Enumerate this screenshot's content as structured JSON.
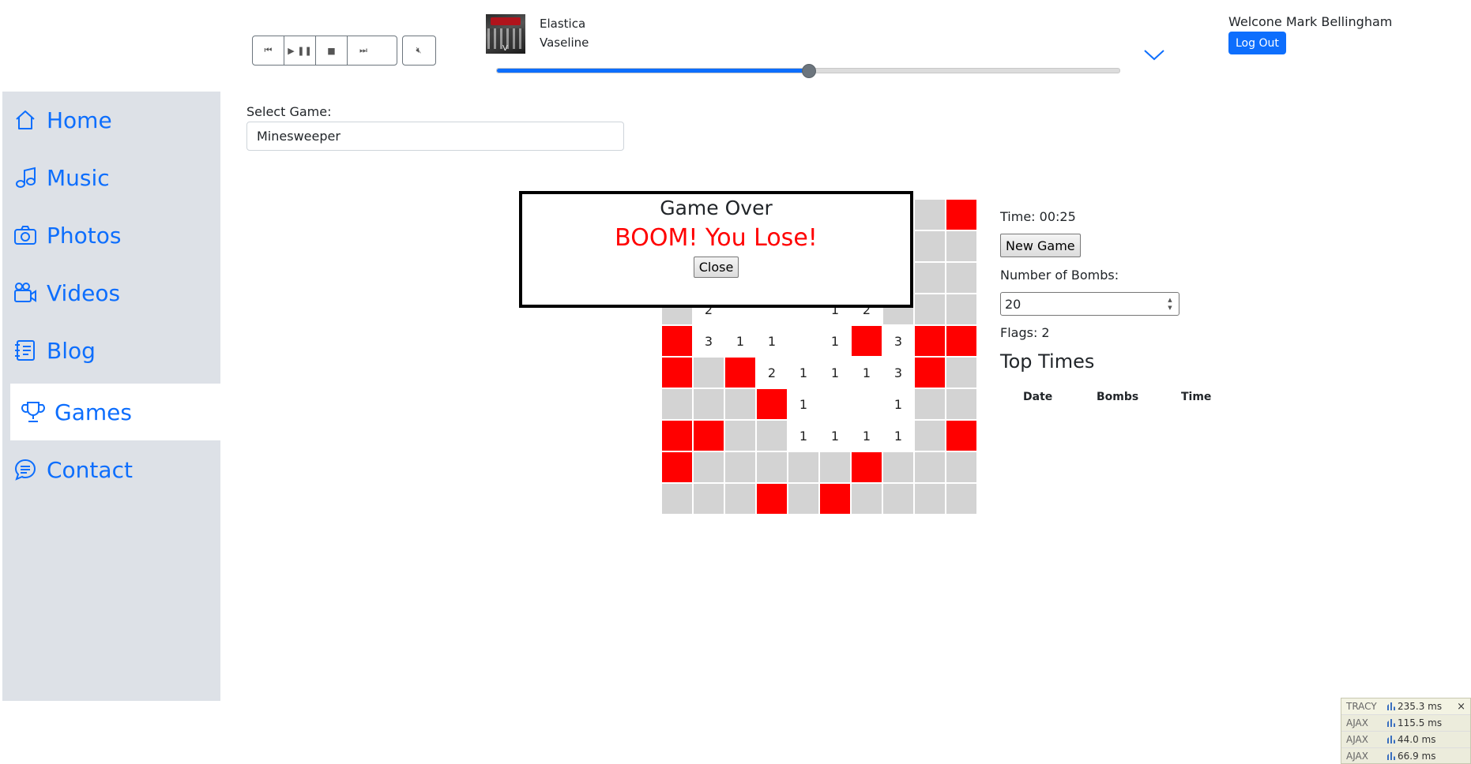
{
  "player": {
    "buttons": [
      "⏮",
      "▶ ❚❚",
      "■",
      "⏭"
    ],
    "mute_icon": "🔇︎",
    "artist": "Elastica",
    "track": "Vaseline",
    "album_art_letter": "V",
    "progress_fraction": 0.5,
    "colors": {
      "accent": "#0d6efd",
      "thumb": "#6c757d"
    }
  },
  "user": {
    "welcome": "Welcone Mark Bellingham",
    "logout_label": "Log Out"
  },
  "sidebar": {
    "items": [
      {
        "label": "Home",
        "icon": "house-icon"
      },
      {
        "label": "Music",
        "icon": "music-note-icon"
      },
      {
        "label": "Photos",
        "icon": "camera-icon"
      },
      {
        "label": "Videos",
        "icon": "video-camera-icon"
      },
      {
        "label": "Blog",
        "icon": "journal-icon"
      },
      {
        "label": "Games",
        "icon": "trophy-icon",
        "active": true
      },
      {
        "label": "Contact",
        "icon": "chat-bubble-icon"
      }
    ]
  },
  "game_select": {
    "label": "Select Game:",
    "value": "Minesweeper"
  },
  "board": {
    "cols": 10,
    "rows": [
      [
        "h",
        "h",
        "h",
        "h",
        "h",
        "h",
        "h",
        "h",
        "h",
        "b"
      ],
      [
        "h",
        "h",
        "h",
        "h",
        "h",
        "h",
        "h",
        "h",
        "h",
        "h"
      ],
      [
        "h",
        "h",
        "h",
        "h",
        "h",
        "h",
        "h",
        "h",
        "h",
        "h"
      ],
      [
        "h",
        "2",
        "",
        "",
        "",
        "1",
        "2",
        "h",
        "h",
        "h"
      ],
      [
        "b",
        "3",
        "1",
        "1",
        "",
        "1",
        "b",
        "3",
        "b",
        "b"
      ],
      [
        "b",
        "h",
        "b",
        "2",
        "1",
        "1",
        "1",
        "3",
        "b",
        "h"
      ],
      [
        "h",
        "h",
        "h",
        "b",
        "1",
        "",
        "",
        "1",
        "h",
        "h"
      ],
      [
        "b",
        "b",
        "h",
        "h",
        "1",
        "1",
        "1",
        "1",
        "h",
        "b"
      ],
      [
        "b",
        "h",
        "h",
        "h",
        "h",
        "h",
        "b",
        "h",
        "h",
        "h"
      ],
      [
        "h",
        "h",
        "h",
        "b",
        "h",
        "b",
        "h",
        "h",
        "h",
        "h"
      ]
    ],
    "colors": {
      "hidden": "#d3d3d3",
      "bomb": "#ff0000",
      "open": "#ffffff"
    }
  },
  "modal": {
    "title": "Game Over",
    "message": "BOOM! You Lose!",
    "close_label": "Close",
    "message_color": "#ff0000"
  },
  "stats": {
    "time_label": "Time: 00:25",
    "new_game_label": "New Game",
    "bombs_label": "Number of Bombs:",
    "bombs_value": "20",
    "flags_label": "Flags: 2",
    "top_times_title": "Top Times",
    "columns": [
      "Date",
      "Bombs",
      "Time"
    ]
  },
  "tracy": {
    "rows": [
      {
        "name": "TRACY",
        "value": "235.3 ms"
      },
      {
        "name": "AJAX",
        "value": "115.5 ms"
      },
      {
        "name": "AJAX",
        "value": "44.0 ms"
      },
      {
        "name": "AJAX",
        "value": "66.9 ms"
      }
    ],
    "close": "×"
  }
}
